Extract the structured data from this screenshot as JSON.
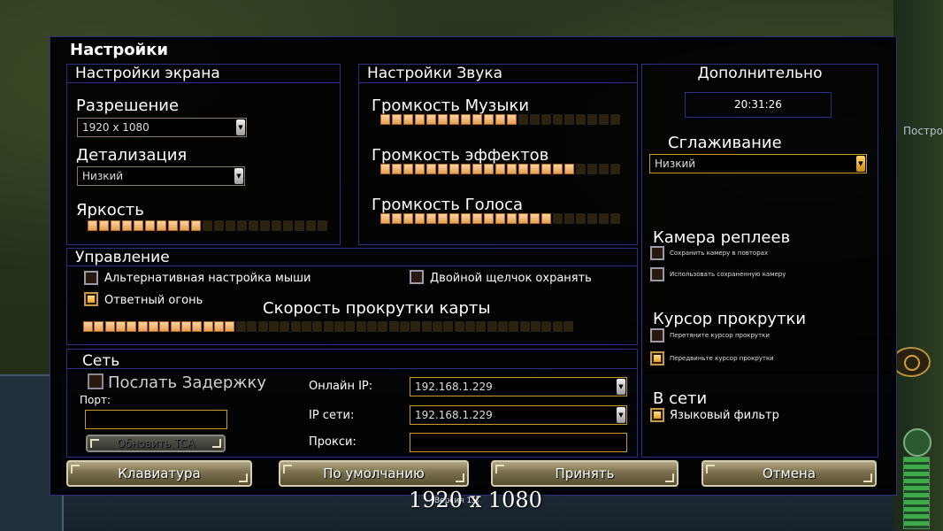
{
  "colors": {
    "accent_gold": "#c89a28",
    "panel_border": "#2c2f8a",
    "slider_on": "#f0b070"
  },
  "dialog": {
    "title": "Настройки"
  },
  "screen": {
    "header": "Настройки экрана",
    "resolution_label": "Разрешение",
    "resolution_value": "1920 x 1080",
    "detail_label": "Детализация",
    "detail_value": "Низкий",
    "brightness_label": "Яркость",
    "brightness": {
      "filled": 10,
      "total": 21
    }
  },
  "sound": {
    "header": "Настройки Звука",
    "music_label": "Громкость Музыки",
    "music": {
      "filled": 12,
      "total": 21
    },
    "effects_label": "Громкость эффектов",
    "effects": {
      "filled": 17,
      "total": 21
    },
    "voice_label": "Громкость Голоса",
    "voice": {
      "filled": 15,
      "total": 21
    }
  },
  "extra": {
    "header": "Дополнительно",
    "clock": "20:31:26",
    "antialias_label": "Сглаживание",
    "antialias_value": "Низкий",
    "replay_camera_label": "Камера реплеев",
    "replay_opt1": "Сохранить камеру в повторах",
    "replay_opt2": "Использовать сохраненную камеру",
    "scroll_cursor_label": "Курсор прокрутки",
    "scroll_opt1": "Перетяните курсор прокрутки",
    "scroll_opt2": "Передвиньте курсор прокрутки",
    "online_label": "В сети",
    "lang_filter": "Языковый фильтр"
  },
  "control": {
    "header": "Управление",
    "alt_mouse": "Альтернативная настройка мыши",
    "double_click": "Двойной щелчок охранять",
    "return_fire": "Ответный огонь",
    "scroll_speed_label": "Скорость прокрутки карты",
    "scroll_speed": {
      "filled": 14,
      "total": 45
    }
  },
  "network": {
    "header": "Сеть",
    "send_delay": "Послать Задержку",
    "port_label": "Порт:",
    "update_btn": "Обновить TCA",
    "online_ip_label": "Онлайн IP:",
    "online_ip": "192.168.1.229",
    "net_ip_label": "IP сети:",
    "net_ip": "192.168.1.229",
    "proxy_label": "Прокси:"
  },
  "buttons": {
    "keyboard": "Клавиатура",
    "default": "По умолчанию",
    "accept": "Принять",
    "cancel": "Отмена"
  },
  "overlay": {
    "resolution": "1920 x 1080",
    "version": "Версия 1.4"
  },
  "hud": {
    "side_label": "Постро"
  }
}
